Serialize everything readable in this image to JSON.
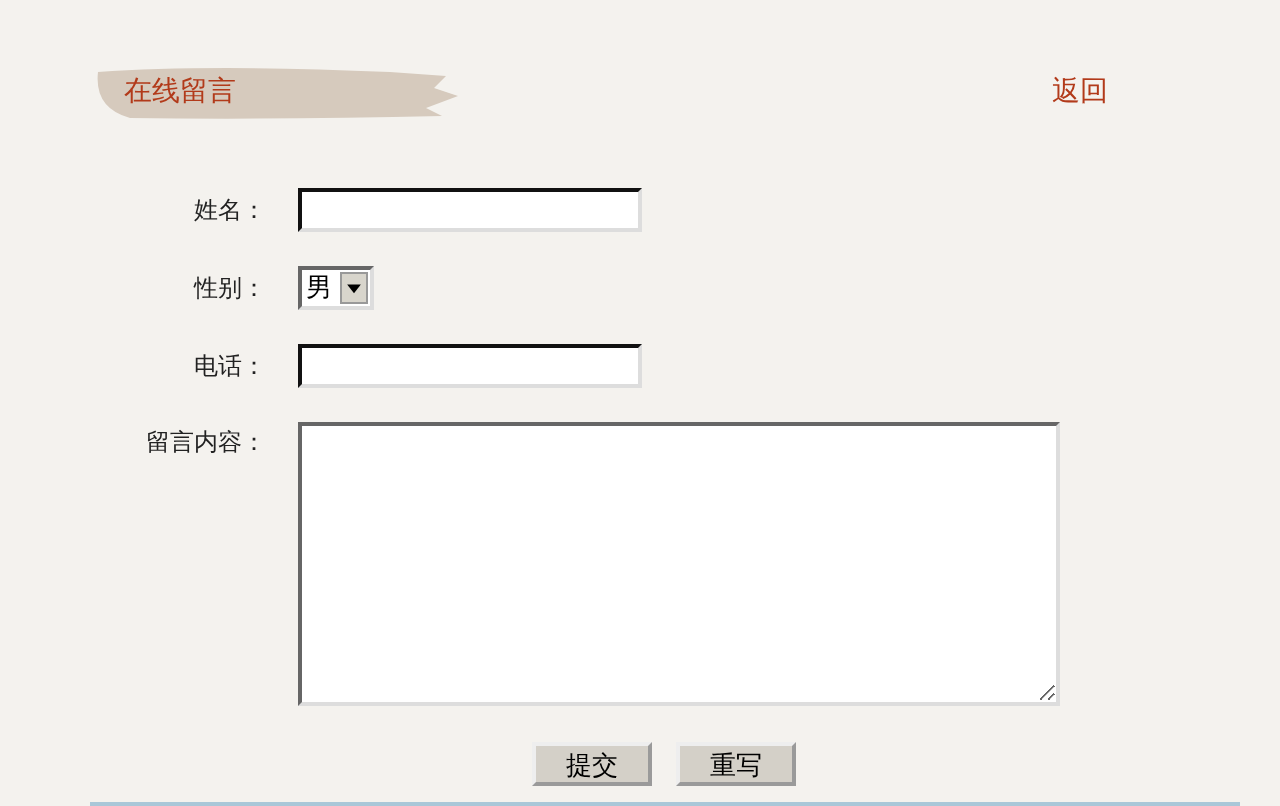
{
  "header": {
    "title": "在线留言",
    "back_link": "返回"
  },
  "form": {
    "fields": [
      {
        "kind": "text",
        "label": "姓名："
      },
      {
        "kind": "select",
        "label": "性别：",
        "value": "男"
      },
      {
        "kind": "text",
        "label": "电话："
      },
      {
        "kind": "textarea",
        "label": "留言内容："
      }
    ],
    "buttons": [
      "提交",
      "重写"
    ]
  }
}
